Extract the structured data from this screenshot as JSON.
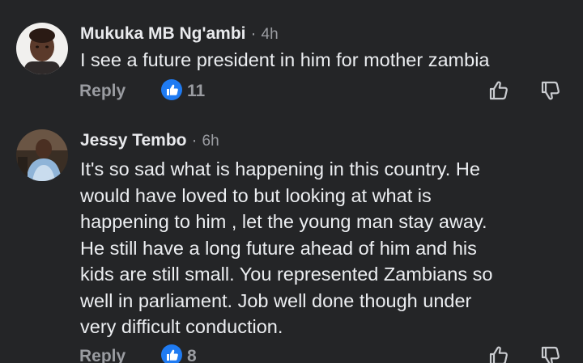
{
  "comments": [
    {
      "author": "Mukuka MB Ng'ambi",
      "separator": "·",
      "time": "4h",
      "text_lines": [
        "I see a future president in him for mother zambia"
      ],
      "reply_label": "Reply",
      "likes": "11",
      "avatar_icon": "avatar-photo"
    },
    {
      "author": "Jessy Tembo",
      "separator": "·",
      "time": "6h",
      "text_lines": [
        "It's so sad what is happening in this country. He",
        "would have loved to but looking at what is",
        "happening to him , let the young man stay away.",
        "He still have a long future ahead of him and his",
        "kids are still small. You represented Zambians so",
        "well in parliament. Job well done though under",
        "very difficult conduction."
      ],
      "reply_label": "Reply",
      "likes": "8",
      "avatar_icon": "avatar-photo"
    }
  ],
  "colors": {
    "background": "#242527",
    "text": "#eceef1",
    "muted": "#9a9ca1",
    "like_accent": "#1f7bf2"
  },
  "icons": {
    "like_badge": "thumbs-up-icon",
    "upvote": "thumbs-up-outline-icon",
    "downvote": "thumbs-down-outline-icon"
  }
}
